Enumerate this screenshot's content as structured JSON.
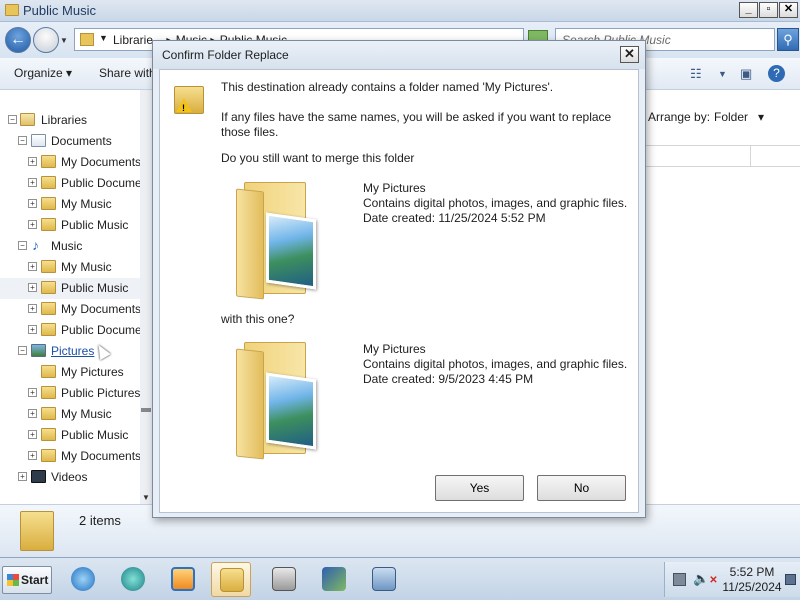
{
  "window": {
    "title": "Public Music",
    "caption_min": "_",
    "caption_max": "▫",
    "caption_close": "✕"
  },
  "address": {
    "breadcrumb": "Librarie... ▸ Music ▸ Public Music",
    "search_placeholder": "Search Public Music"
  },
  "toolbar": {
    "organize": "Organize",
    "share_with": "Share with",
    "arrange_by_label": "Arrange by:",
    "arrange_by_value": "Folder"
  },
  "tree": {
    "libraries": "Libraries",
    "documents": "Documents",
    "doc_my_documents": "My Documents",
    "doc_public_documents": "Public Docume",
    "doc_my_music": "My Music",
    "doc_public_music": "Public Music",
    "music": "Music",
    "mus_my_music": "My Music",
    "mus_public_music": "Public Music",
    "mus_my_documents": "My Documents",
    "mus_public_documents": "Public Docume",
    "pictures": "Pictures",
    "pic_my_pictures": "My Pictures",
    "pic_public_pictures": "Public Pictures",
    "pic_my_music": "My Music",
    "pic_public_music": "Public Music",
    "pic_my_documents": "My Documents",
    "videos": "Videos"
  },
  "details": {
    "item_count": "2 items"
  },
  "dialog": {
    "title": "Confirm Folder Replace",
    "close": "✕",
    "line1": "This destination already contains a folder named 'My Pictures'.",
    "line2a": "If any files have the same names, you will be asked if you want to replace",
    "line2b": "those files.",
    "question": "Do you still want to merge this folder",
    "folder1": {
      "name": "My Pictures",
      "desc": "Contains digital photos, images, and graphic files.",
      "date": "Date created: 11/25/2024 5:52 PM"
    },
    "with_this": "with this one?",
    "folder2": {
      "name": "My Pictures",
      "desc": "Contains digital photos, images, and graphic files.",
      "date": "Date created: 9/5/2023 4:45 PM"
    },
    "yes": "Yes",
    "no": "No"
  },
  "taskbar": {
    "start": "Start",
    "time": "5:52 PM",
    "date": "11/25/2024"
  },
  "icons": {
    "folder": "folder-icon",
    "warning": "warning-icon",
    "ie": "internet-explorer-icon",
    "media": "media-player-icon",
    "explorer": "explorer-icon",
    "calculator": "calculator-icon"
  },
  "colors": {
    "accent": "#1f5aa5",
    "link": "#1b4fa8",
    "folder": "#e0b84b"
  }
}
